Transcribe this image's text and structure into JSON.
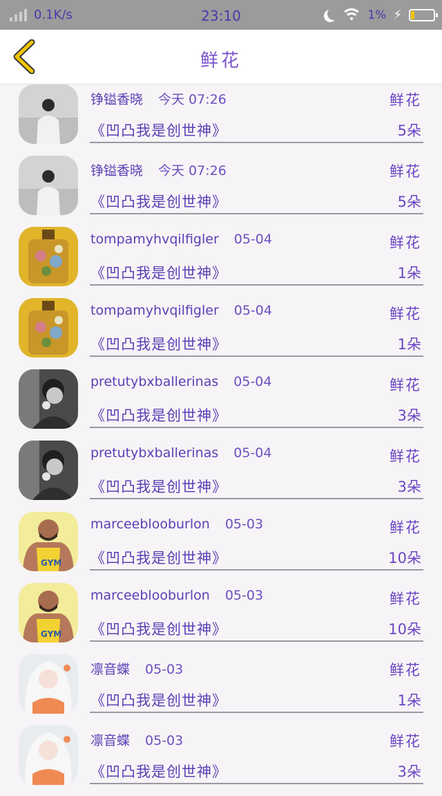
{
  "status_bar": {
    "speed": "0.1K/s",
    "time": "23:10",
    "battery_pct": "1%",
    "battery_level": 0.1,
    "icons": [
      "signal-icon",
      "moon-icon",
      "wifi-icon",
      "charging-icon",
      "battery-icon"
    ]
  },
  "header": {
    "title": "鲜花",
    "back_icon": "chevron-left-icon"
  },
  "colors": {
    "accent": "#6b45c3",
    "back_arrow": "#f0c400",
    "status_bar_bg": "#9b9b9b"
  },
  "records": [
    {
      "name": "铮镒香晓",
      "time": "今天 07:26",
      "label": "鲜花",
      "book": "《凹凸我是创世神》",
      "count": "5朵",
      "avatar": "man-on-beach"
    },
    {
      "name": "铮镒香晓",
      "time": "今天 07:26",
      "label": "鲜花",
      "book": "《凹凸我是创世神》",
      "count": "5朵",
      "avatar": "man-on-beach"
    },
    {
      "name": "tompamyhvqilfigler",
      "time": "05-04",
      "label": "鲜花",
      "book": "《凹凸我是创世神》",
      "count": "1朵",
      "avatar": "perfume-bottle"
    },
    {
      "name": "tompamyhvqilfigler",
      "time": "05-04",
      "label": "鲜花",
      "book": "《凹凸我是创世神》",
      "count": "1朵",
      "avatar": "perfume-bottle"
    },
    {
      "name": "pretutybxballerinas",
      "time": "05-04",
      "label": "鲜花",
      "book": "《凹凸我是创世神》",
      "count": "3朵",
      "avatar": "man-smoking"
    },
    {
      "name": "pretutybxballerinas",
      "time": "05-04",
      "label": "鲜花",
      "book": "《凹凸我是创世神》",
      "count": "3朵",
      "avatar": "man-smoking"
    },
    {
      "name": "marceeblooburlon",
      "time": "05-03",
      "label": "鲜花",
      "book": "《凹凸我是创世神》",
      "count": "10朵",
      "avatar": "gym-man"
    },
    {
      "name": "marceeblooburlon",
      "time": "05-03",
      "label": "鲜花",
      "book": "《凹凸我是创世神》",
      "count": "10朵",
      "avatar": "gym-man"
    },
    {
      "name": "凛音蝶",
      "time": "05-03",
      "label": "鲜花",
      "book": "《凹凸我是创世神》",
      "count": "1朵",
      "avatar": "anime-girl"
    },
    {
      "name": "凛音蝶",
      "time": "05-03",
      "label": "鲜花",
      "book": "《凹凸我是创世神》",
      "count": "3朵",
      "avatar": "anime-girl"
    }
  ]
}
